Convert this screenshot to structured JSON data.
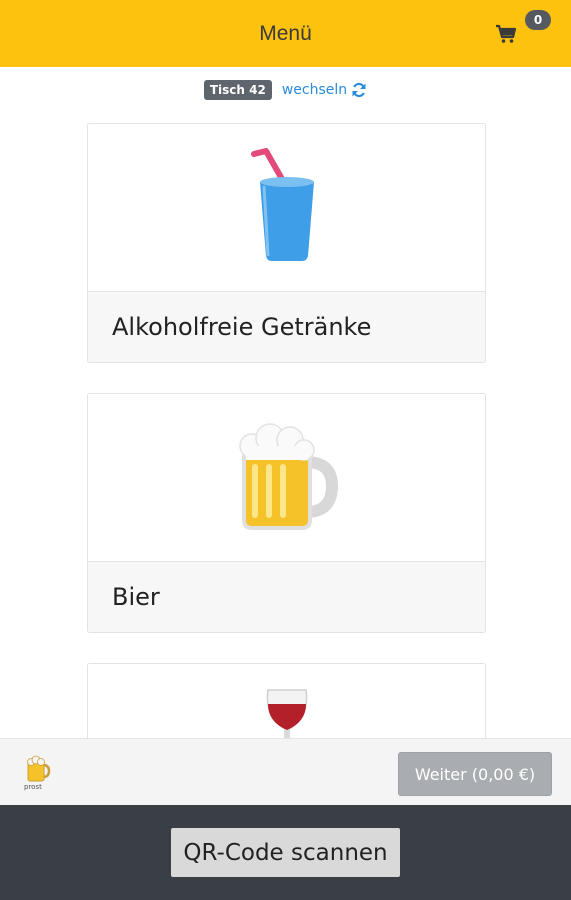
{
  "header": {
    "title": "Menü",
    "cart_count": "0",
    "cart_icon": "shopping-cart-icon"
  },
  "table": {
    "badge": "Tisch 42",
    "switch_label": "wechseln",
    "switch_icon": "refresh-icon"
  },
  "categories": [
    {
      "label": "Alkoholfreie Getränke",
      "icon": "cup-with-straw-icon"
    },
    {
      "label": "Bier",
      "icon": "beer-mug-icon"
    },
    {
      "label": "",
      "icon": "wine-glass-icon"
    }
  ],
  "bottom_bar": {
    "logo_text": "prost",
    "continue_label": "Weiter (0,00 €)"
  },
  "footer": {
    "qr_label": "QR-Code scannen"
  },
  "colors": {
    "header": "#fdc20e",
    "link": "#2a8bdc",
    "footer": "#3a3e45"
  }
}
